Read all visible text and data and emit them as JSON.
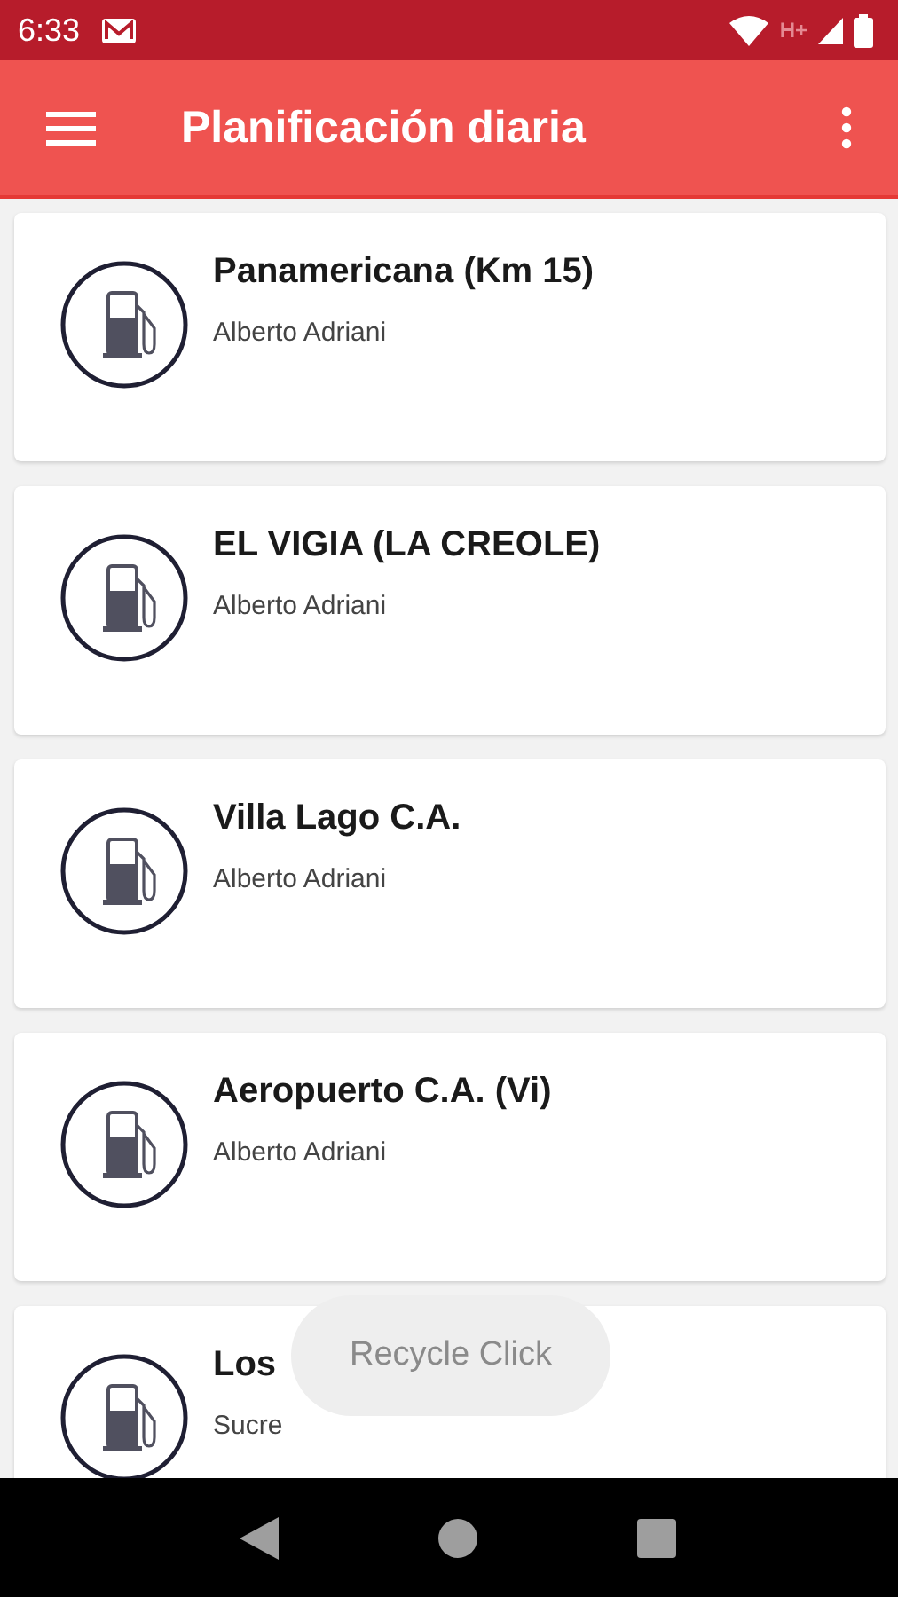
{
  "status_bar": {
    "time": "6:33",
    "network": "H+"
  },
  "toolbar": {
    "title": "Planificación diaria"
  },
  "stations": [
    {
      "name": "Panamericana (Km 15)",
      "subtitle": "Alberto Adriani"
    },
    {
      "name": "EL VIGIA (LA CREOLE)",
      "subtitle": "Alberto Adriani"
    },
    {
      "name": "Villa Lago C.A.",
      "subtitle": "Alberto Adriani"
    },
    {
      "name": "Aeropuerto C.A. (Vi)",
      "subtitle": "Alberto Adriani"
    },
    {
      "name": "Los",
      "subtitle": "Sucre"
    }
  ],
  "toast": {
    "text": "Recycle Click"
  }
}
